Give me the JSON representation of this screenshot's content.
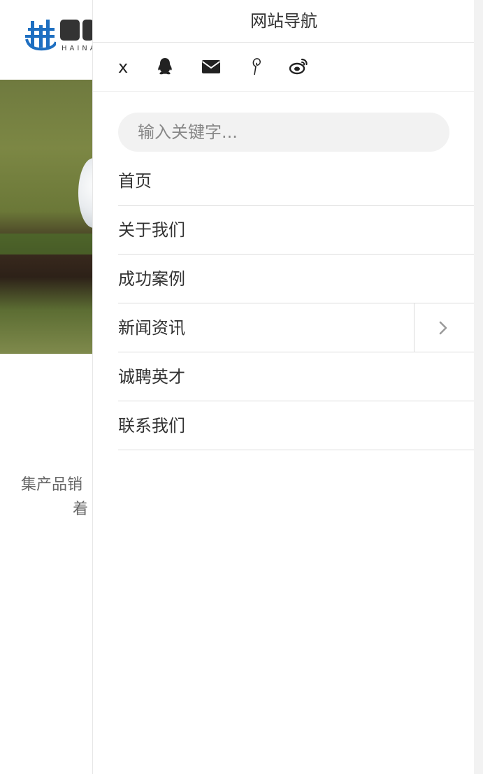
{
  "background": {
    "logo": {
      "subtitle": "HAINA"
    },
    "intro": {
      "line1": "集产品销",
      "line2": "着"
    }
  },
  "drawer": {
    "title": "网站导航",
    "close_label": "x",
    "social": [
      "qq-icon",
      "mail-icon",
      "pin-icon",
      "weibo-icon"
    ],
    "search": {
      "placeholder": "输入关键字..."
    },
    "menu": [
      {
        "label": "首页"
      },
      {
        "label": "关于我们"
      },
      {
        "label": "成功案例"
      },
      {
        "label": "新闻资讯",
        "has_submenu": true
      },
      {
        "label": "诚聘英才"
      },
      {
        "label": "联系我们"
      }
    ]
  },
  "colors": {
    "accent": "#1e6fc1",
    "text": "#333333",
    "divider": "#dcdcdc",
    "search_bg": "#f2f2f2"
  }
}
